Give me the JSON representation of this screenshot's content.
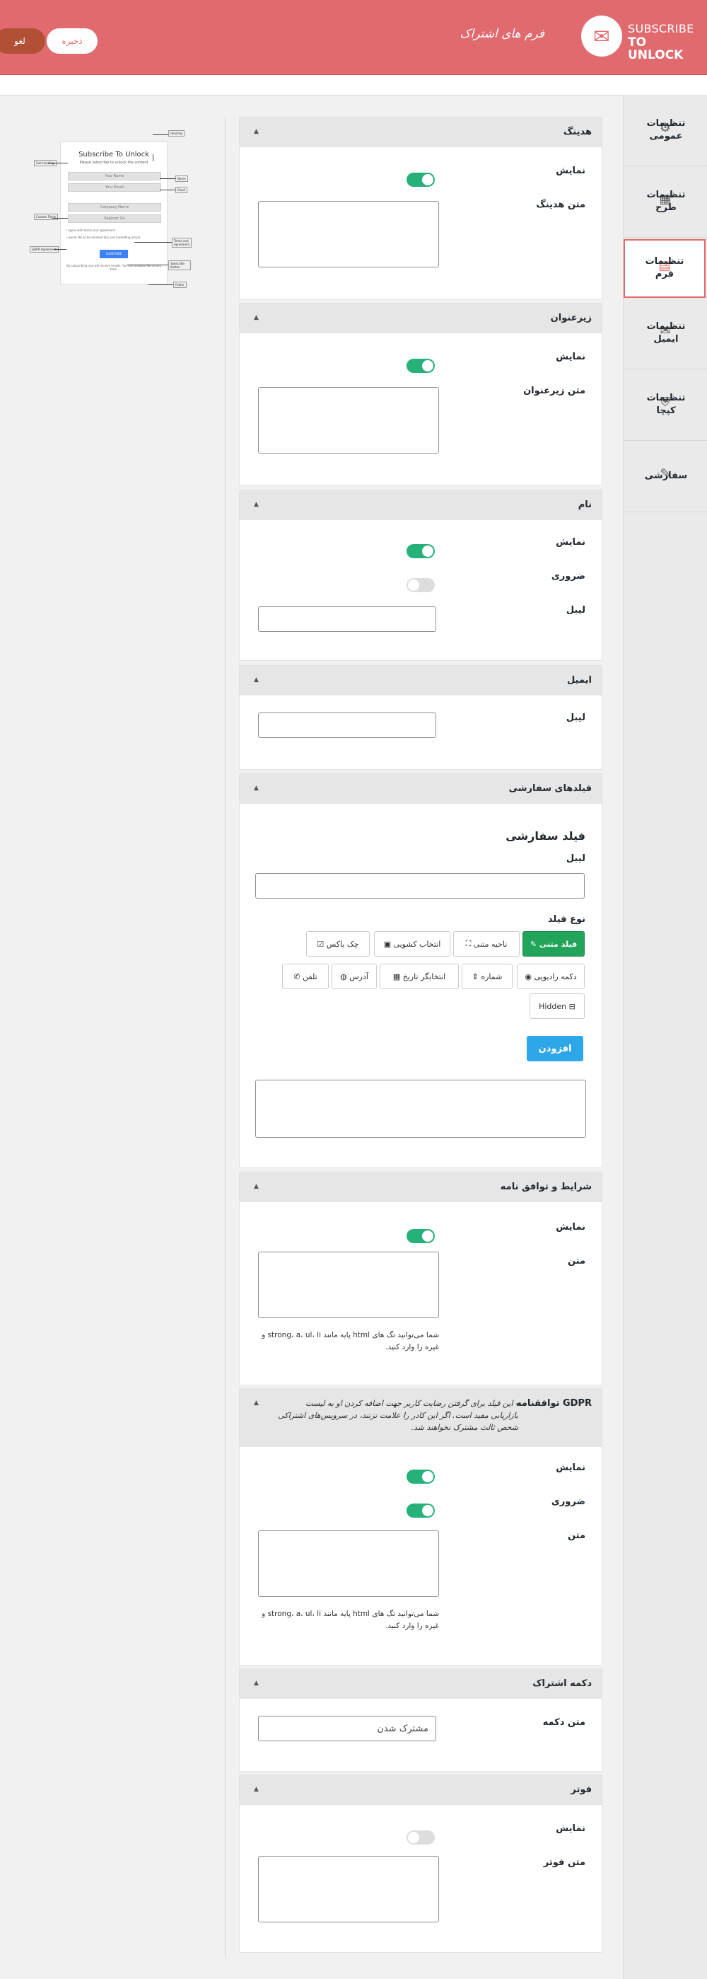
{
  "header": {
    "brand_line1": "SUBSCRIBE",
    "brand_line2": "TO UNLOCK",
    "page_title": "فرم های اشتراک",
    "save_label": "ذخیره",
    "cancel_label": "لغو"
  },
  "sidebar": {
    "items": [
      {
        "label": "تنظیمات عمومی",
        "icon": "gear-icon"
      },
      {
        "label": "تنظیمات طرح",
        "icon": "layout-icon"
      },
      {
        "label": "تنظیمات فرم",
        "icon": "form-icon",
        "active": true
      },
      {
        "label": "تنظیمات ایمیل",
        "icon": "envelope-icon"
      },
      {
        "label": "تنظیمات کپچا",
        "icon": "shield-icon"
      },
      {
        "label": "سفارشی",
        "icon": "brush-icon"
      }
    ]
  },
  "preview": {
    "title": "Subscribe To Unlock",
    "subtitle": "Please subscribe to unlock the content",
    "field_name": "Your Name",
    "field_email": "Your Email",
    "field_company": "Company Name",
    "field_register": "Register On",
    "terms": "I agree with terms and agreement",
    "gdpr": "I would like to be emailed tips and marketing emails",
    "button": "SUBSCRIBE",
    "footer": "By subscribing you will receive emails. You can unsubscribe at any time.",
    "tags": {
      "heading": "Heading",
      "sub_heading": "Sub Heading",
      "name": "Name",
      "email": "Email",
      "custom_fields": "Custom Fields",
      "terms": "Terms and Agreement",
      "gdpr": "GDPR Agreement",
      "button": "Subscribe Button",
      "footer": "Footer"
    }
  },
  "sections": {
    "heading": {
      "title": "هدینگ",
      "show_label": "نمایش",
      "text_label": "متن هدینگ"
    },
    "subheading": {
      "title": "زیرعنوان",
      "show_label": "نمایش",
      "text_label": "متن زیرعنوان"
    },
    "name": {
      "title": "نام",
      "show_label": "نمایش",
      "required_label": "ضروری",
      "label_label": "لیبل"
    },
    "email": {
      "title": "ایمیل",
      "label_label": "لیبل"
    },
    "custom": {
      "title": "فیلدهای سفارشی",
      "heading": "فیلد سفارشی",
      "label_label": "لیبل",
      "type_label": "نوع فیلد",
      "types_row1": [
        "فیلد متنی",
        "ناحیه متنی",
        "انتخاب کشویی",
        "چک باکس"
      ],
      "types_row2": [
        "دکمه رادیویی",
        "شماره",
        "انتخابگر تاریخ",
        "آدرس",
        "تلفن"
      ],
      "types_row3": [
        "Hidden"
      ],
      "add_label": "افزودن"
    },
    "terms": {
      "title": "شرایط و توافق نامه",
      "show_label": "نمایش",
      "text_label": "متن",
      "hint": "شما می‌توانید تگ های html پایه مانند strong، a، ul، li و غیره را وارد کنید."
    },
    "gdpr": {
      "title": "توافقنامه GDPR",
      "note": "- این فیلد برای گرفتن رضایت کاربر جهت اضافه کردن او به لیست بازاریابی مفید است. اگر این کادر را علامت نزنند، در سرویس‌های اشتراکی شخص ثالث مشترک نخواهند شد.",
      "show_label": "نمایش",
      "required_label": "ضروری",
      "text_label": "متن",
      "hint": "شما می‌توانید تگ های html پایه مانند strong، a، ul، li و غیره را وارد کنید."
    },
    "button": {
      "title": "دکمه اشتراک",
      "text_label": "متن دکمه",
      "value": "مشترک شدن"
    },
    "footer": {
      "title": "فوتر",
      "show_label": "نمایش",
      "text_label": "متن فوتر"
    }
  }
}
